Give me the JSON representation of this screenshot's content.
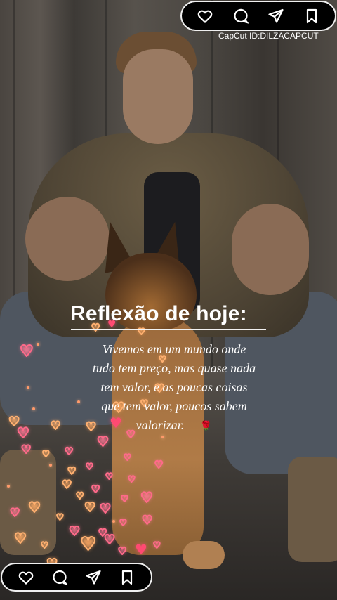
{
  "top_bar": {
    "icons": [
      "heart-icon",
      "comment-icon",
      "send-icon",
      "bookmark-icon"
    ]
  },
  "watermark": "CapCut ID:DILZACAPCUT",
  "post": {
    "title": "Reflexão de hoje:",
    "lines": [
      "Vivemos em um mundo onde",
      "tudo tem preço, mas quase nada",
      "tem valor, e as poucas coisas",
      "que tem valor, poucos sabem",
      "valorizar."
    ],
    "emoji": "🌹"
  },
  "bottom_bar": {
    "icons": [
      "heart-icon",
      "comment-icon",
      "send-icon",
      "bookmark-icon"
    ]
  },
  "colors": {
    "bar_bg": "#000000",
    "bar_border": "#f0f0f0",
    "text": "#ffffff",
    "heart_pink": "#ff4a72",
    "heart_gold": "#ffb070"
  }
}
